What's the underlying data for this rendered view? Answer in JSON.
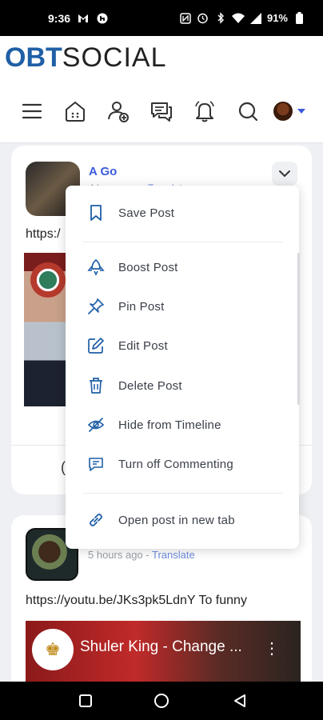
{
  "status_bar": {
    "time": "9:36",
    "battery": "91%"
  },
  "brand": {
    "logo_part1": "OBT",
    "logo_part2": "SOCIAL"
  },
  "post1": {
    "author": "A Go",
    "time_ago": "4 hours ago",
    "separator": " - ",
    "translate": "Translate",
    "text": "https:/"
  },
  "menu": {
    "items": [
      {
        "label": "Save Post",
        "icon": "bookmark-icon"
      },
      {
        "label": "Boost Post",
        "icon": "rocket-icon"
      },
      {
        "label": "Pin Post",
        "icon": "pin-icon"
      },
      {
        "label": "Edit Post",
        "icon": "edit-icon"
      },
      {
        "label": "Delete Post",
        "icon": "trash-icon"
      },
      {
        "label": "Hide from Timeline",
        "icon": "eye-off-icon"
      },
      {
        "label": "Turn off Commenting",
        "icon": "comment-off-icon"
      },
      {
        "label": "Open post in new tab",
        "icon": "link-icon"
      }
    ]
  },
  "post2": {
    "time_ago": "5 hours ago",
    "separator": " - ",
    "translate": "Translate",
    "text": "https://youtu.be/JKs3pk5LdnY To funny",
    "video_title": "Shuler King - Change ..."
  },
  "colors": {
    "accent": "#3b5bdb",
    "brand_blue": "#1f5fa6",
    "menu_icon": "#1f5fa6"
  }
}
